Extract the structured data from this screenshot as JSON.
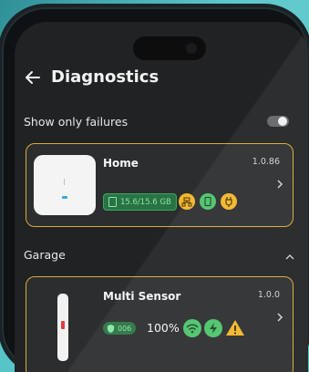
{
  "header": {
    "title": "Diagnostics",
    "back_icon": "arrow-left-icon"
  },
  "filter": {
    "label": "Show only failures",
    "toggle_on": false
  },
  "devices": [
    {
      "name": "Home",
      "version": "1.0.86",
      "storage": "15.6/15.6 GB",
      "status_icons": [
        "network-icon",
        "sd-card-icon",
        "power-plug-icon"
      ],
      "status_colors": [
        "#f3b21e",
        "#43c063",
        "#f3b21e"
      ]
    }
  ],
  "section": {
    "label": "Garage",
    "collapse_icon": "chevron-up-icon"
  },
  "sensor": {
    "name": "Multi Sensor",
    "version": "1.0.0",
    "battery_code": "006",
    "percent": "100%",
    "status_icons": [
      "wifi-icon",
      "bolt-icon",
      "warning-icon"
    ],
    "status_colors": [
      "#43c063",
      "#43c063",
      "#f3b21e"
    ]
  },
  "colors": {
    "accent_border": "#d9a52b",
    "ok_green": "#43c063",
    "warn_orange": "#f3b21e"
  }
}
